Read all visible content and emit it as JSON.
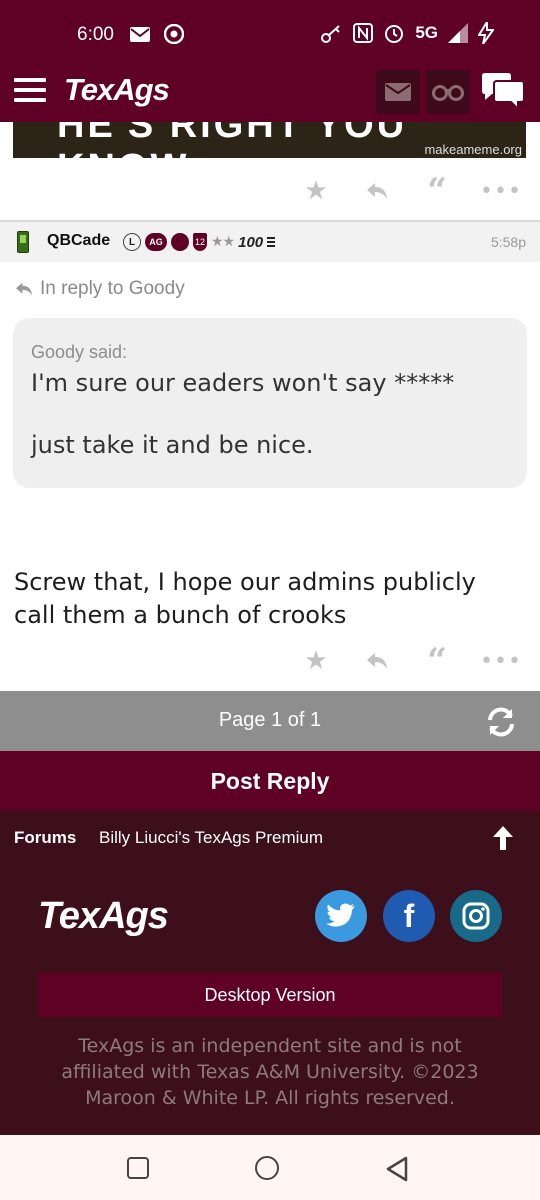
{
  "status_bar": {
    "time": "6:00",
    "network": "5G"
  },
  "header": {
    "logo": "TexAgs"
  },
  "meme": {
    "caption": "HE'S RIGHT YOU KNOW",
    "watermark": "makeameme.org"
  },
  "post": {
    "username": "QBCade",
    "badges": [
      "L",
      "AG",
      "12"
    ],
    "stars": "★★",
    "score": "100",
    "time": "5:58p",
    "reply_to": "In reply to Goody",
    "quote": {
      "author": "Goody said:",
      "line1": "I'm sure our eaders won't say *****",
      "line2": "just take it and be nice."
    },
    "body": "Screw that, I hope our admins publicly call them a bunch of crooks"
  },
  "pagination": {
    "label": "Page 1 of 1"
  },
  "post_reply": {
    "label": "Post Reply"
  },
  "breadcrumb": {
    "forums": "Forums",
    "board": "Billy Liucci's TexAgs Premium"
  },
  "footer": {
    "logo": "TexAgs",
    "desktop_version": "Desktop Version",
    "disclaimer": "TexAgs is an independent site and is not affiliated with Texas A&M University. ©2023 Maroon & White LP. All rights reserved."
  },
  "icons": {
    "status": [
      "mail-icon",
      "chrome-icon",
      "key-icon",
      "nfc-icon",
      "alarm-icon",
      "signal-icon",
      "charging-icon"
    ],
    "header": [
      "menu-icon",
      "mail-icon",
      "binoculars-icon",
      "chat-icon"
    ],
    "actions": [
      "star-icon",
      "reply-icon",
      "quote-icon",
      "more-icon"
    ],
    "social": [
      "twitter-icon",
      "facebook-icon",
      "instagram-icon"
    ]
  },
  "colors": {
    "maroon": "#5f0025",
    "footer_bg": "#3c0f1a",
    "page_bar": "#8e8e8e",
    "twitter": "#3a99df",
    "facebook": "#1f5bb0",
    "instagram": "#176a8a"
  }
}
